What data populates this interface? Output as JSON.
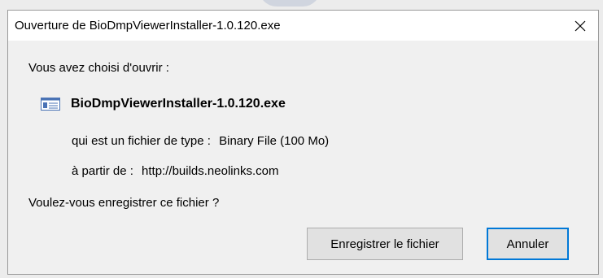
{
  "dialog": {
    "title": "Ouverture de BioDmpViewerInstaller-1.0.120.exe",
    "close_icon": "close-icon",
    "prompt": "Vous avez choisi d'ouvrir :",
    "file": {
      "icon": "executable-file-icon",
      "name": "BioDmpViewerInstaller-1.0.120.exe"
    },
    "type_label": "qui est un fichier de type :",
    "type_value": "Binary File (100 Mo)",
    "from_label": "à partir de :",
    "from_value": "http://builds.neolinks.com",
    "question": "Voulez-vous enregistrer ce fichier ?",
    "buttons": {
      "save_label": "Enregistrer le fichier",
      "cancel_label": "Annuler"
    },
    "colors": {
      "focus_border": "#0078d7",
      "button_bg": "#e1e1e1",
      "dialog_bg": "#f0f0f0",
      "titlebar_bg": "#ffffff"
    }
  }
}
